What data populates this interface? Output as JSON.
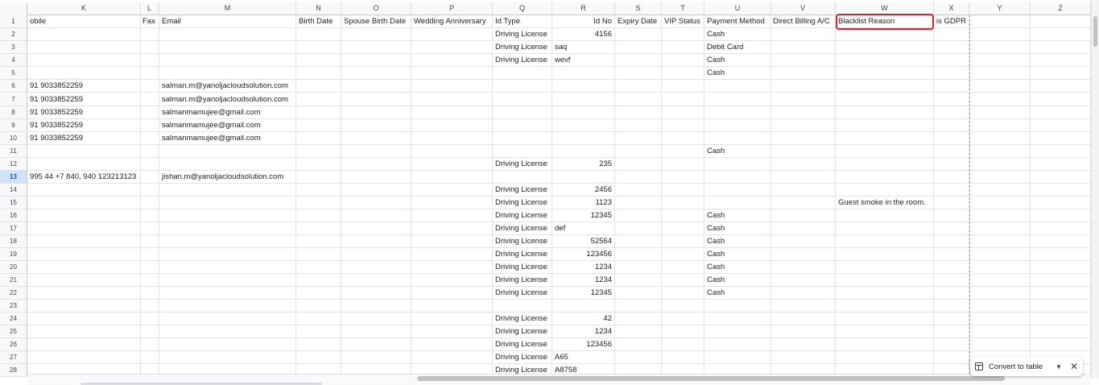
{
  "columns": [
    {
      "letter": "K"
    },
    {
      "letter": "L"
    },
    {
      "letter": "M"
    },
    {
      "letter": "N"
    },
    {
      "letter": "O"
    },
    {
      "letter": "P"
    },
    {
      "letter": "Q"
    },
    {
      "letter": "R"
    },
    {
      "letter": "S"
    },
    {
      "letter": "T"
    },
    {
      "letter": "U"
    },
    {
      "letter": "V"
    },
    {
      "letter": "W"
    },
    {
      "letter": "X"
    },
    {
      "letter": "Y"
    },
    {
      "letter": "Z"
    }
  ],
  "selected_row": "13",
  "rows": [
    {
      "n": "1",
      "K": "obile",
      "L": "Fax",
      "M": "Email",
      "N": "Birth Date",
      "O": "Spouse Birth Date",
      "P": "Wedding Anniversary",
      "Q": "Id Type",
      "R": "Id No",
      "S": "Expiry Date",
      "T": "VIP Status",
      "U": "Payment Method",
      "V": "Direct Billing A/C",
      "W": "Blacklist Reason",
      "X": "is GDPR"
    },
    {
      "n": "2",
      "Q": "Driving License",
      "R": "4156",
      "U": "Cash"
    },
    {
      "n": "3",
      "Q": "Driving License",
      "Rt": "saq",
      "U": "Debit Card"
    },
    {
      "n": "4",
      "Q": "Driving License",
      "Rt": "wevf",
      "U": "Cash"
    },
    {
      "n": "5",
      "U": "Cash"
    },
    {
      "n": "6",
      "K": "91 9033852259",
      "M": "salman.m@yanoljacloudsolution.com"
    },
    {
      "n": "7",
      "K": "91 9033852259",
      "M": "salman.m@yanoljacloudsolution.com"
    },
    {
      "n": "8",
      "K": "91 9033852259",
      "M": "salmanmamujee@gmail.com"
    },
    {
      "n": "9",
      "K": "91 9033852259",
      "M": "salmanmamujee@gmail.com"
    },
    {
      "n": "10",
      "K": "91 9033852259",
      "M": "salmanmamujee@gmail.com"
    },
    {
      "n": "11",
      "U": "Cash"
    },
    {
      "n": "12",
      "Q": "Driving License",
      "R": "235"
    },
    {
      "n": "13",
      "K": "995 44 +7 840, 940 123213123",
      "M": "jishan.m@yanoljacloudsolution.com"
    },
    {
      "n": "14",
      "Q": "Driving License",
      "R": "2456"
    },
    {
      "n": "15",
      "Q": "Driving License",
      "R": "1123",
      "W": "Guest smoke in the room."
    },
    {
      "n": "16",
      "Q": "Driving License",
      "R": "12345",
      "U": "Cash"
    },
    {
      "n": "17",
      "Q": "Driving License",
      "Rt": "def",
      "U": "Cash"
    },
    {
      "n": "18",
      "Q": "Driving License",
      "R": "52564",
      "U": "Cash"
    },
    {
      "n": "19",
      "Q": "Driving License",
      "R": "123456",
      "U": "Cash"
    },
    {
      "n": "20",
      "Q": "Driving License",
      "R": "1234",
      "U": "Cash"
    },
    {
      "n": "21",
      "Q": "Driving License",
      "R": "1234",
      "U": "Cash"
    },
    {
      "n": "22",
      "Q": "Driving License",
      "R": "12345",
      "U": "Cash"
    },
    {
      "n": "23"
    },
    {
      "n": "24",
      "Q": "Driving License",
      "R": "42"
    },
    {
      "n": "25",
      "Q": "Driving License",
      "R": "1234"
    },
    {
      "n": "26",
      "Q": "Driving License",
      "R": "123456"
    },
    {
      "n": "27",
      "Q": "Driving License",
      "Rt": "A65"
    },
    {
      "n": "28",
      "Q": "Driving License",
      "Rt": "A8758"
    }
  ],
  "convert_popup": {
    "label": "Convert to table",
    "icon": "table-icon",
    "close_icon": "close-icon",
    "caret_icon": "caret-down-icon"
  },
  "highlight_color": "#e0202a"
}
